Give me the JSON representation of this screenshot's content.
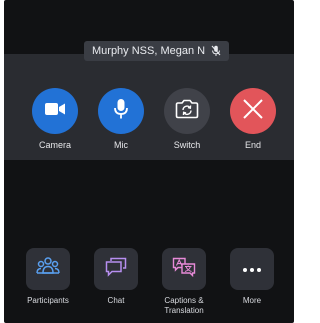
{
  "participant_tooltip": {
    "name": "Murphy NSS, Megan N",
    "icon": "mic-muted-icon"
  },
  "call_controls": [
    {
      "label": "Camera",
      "icon": "camera-icon",
      "color": "#2272d6"
    },
    {
      "label": "Mic",
      "icon": "microphone-icon",
      "color": "#2272d6"
    },
    {
      "label": "Switch",
      "icon": "switch-camera-icon",
      "color": "#404249"
    },
    {
      "label": "End",
      "icon": "close-icon",
      "color": "#e2555a"
    }
  ],
  "bottom_bar": [
    {
      "label": "Participants",
      "icon": "participants-icon"
    },
    {
      "label": "Chat",
      "icon": "chat-icon"
    },
    {
      "label": "Captions &\nTranslation",
      "icon": "captions-translation-icon"
    },
    {
      "label": "More",
      "icon": "more-dots-icon"
    }
  ]
}
